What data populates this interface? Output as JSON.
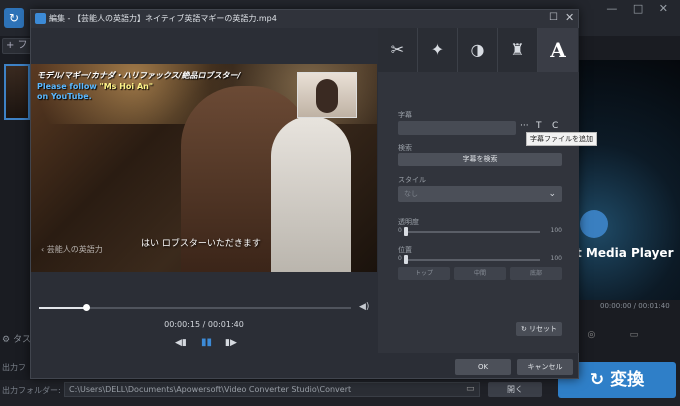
{
  "background": {
    "add_button": "+ フ",
    "preview_text": "t Media Player",
    "time": "00:00:00 / 00:01:40",
    "task_label": "タス",
    "output_label1": "出力フ",
    "output_label2": "出力フォルダー:",
    "output_path": "C:\\Users\\DELL\\Documents\\Apowersoft\\Video Converter Studio\\Convert",
    "open_button": "開く",
    "convert_button": "変換"
  },
  "dialog": {
    "title": "編集 - 【芸能人の英語力】ネイティブ英語マギーの英語力.mp4",
    "video": {
      "subtitle_top_line1": "モデル/マギー/カナダ・ハリファックス/絶品ロブスター/",
      "subtitle_top_line2_pre": "Please follow ",
      "subtitle_top_line2_highlight": "\"Ms Hoi An\"",
      "subtitle_top_line3": "on YouTube.",
      "subtitle_bottom": "はい ロブスターいただきます",
      "watermark": "芸能人の英語力"
    },
    "player": {
      "progress_fraction": 0.15,
      "current_time": "00:00:15",
      "separator": " / ",
      "total_time": "00:01:40"
    },
    "tabs": [
      {
        "name": "crop",
        "icon": "scissors-icon"
      },
      {
        "name": "effect",
        "icon": "magic-wand-icon"
      },
      {
        "name": "adjust",
        "icon": "brightness-icon"
      },
      {
        "name": "watermark",
        "icon": "stamp-icon"
      },
      {
        "name": "subtitle",
        "icon": "text-A-icon",
        "active": true,
        "label": "A"
      }
    ],
    "subtitle_panel": {
      "subtitle_label": "字幕",
      "more_button": "···",
      "text_button": "T",
      "c_button": "C",
      "tooltip": "字幕ファイルを追加",
      "search_label": "検索",
      "search_button": "字幕を検索",
      "style_label": "スタイル",
      "style_value": "なし",
      "opacity_label": "透明度",
      "opacity_min": "0",
      "opacity_max": "100",
      "position_label": "位置",
      "position_min": "0",
      "position_max": "100",
      "position_buttons": [
        "トップ",
        "中間",
        "底部"
      ],
      "reset_button": "リセット"
    },
    "ok_button": "OK",
    "cancel_button": "キャンセル"
  }
}
